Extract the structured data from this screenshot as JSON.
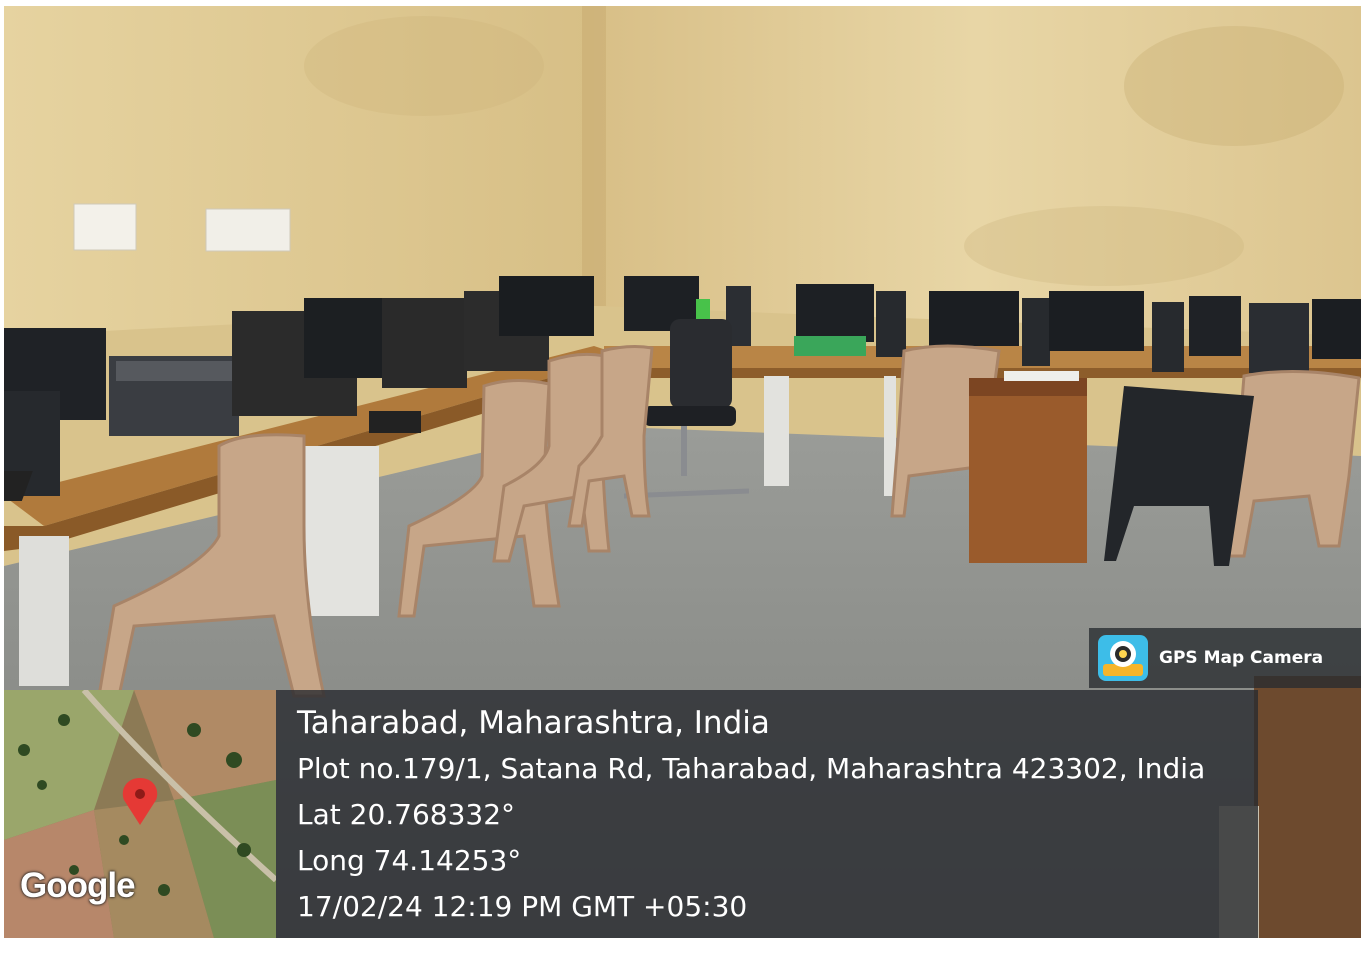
{
  "badge": {
    "app_name": "GPS Map Camera",
    "icon": "map-pin-camera-icon"
  },
  "map": {
    "provider_logo": "Google",
    "marker_icon": "map-marker-icon",
    "marker_color": "#e53935"
  },
  "location": {
    "title": "Taharabad, Maharashtra, India",
    "address": "Plot no.179/1, Satana Rd, Taharabad, Maharashtra 423302, India",
    "latitude": "Lat 20.768332°",
    "longitude": "Long 74.14253°",
    "datetime": "17/02/24 12:19 PM GMT +05:30"
  },
  "colors": {
    "overlay": "#282b30",
    "wall": "#e2cd98",
    "floor": "#8b8d89"
  }
}
